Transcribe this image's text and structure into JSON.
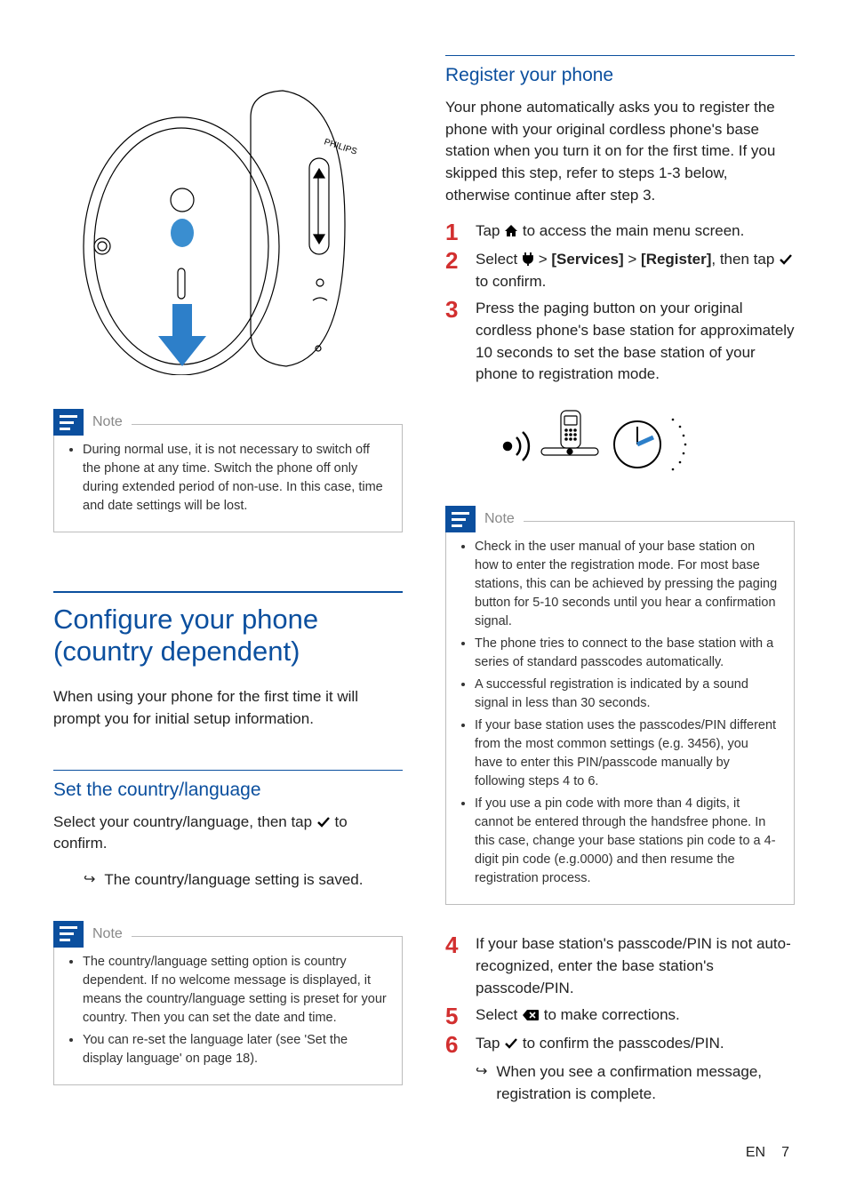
{
  "left": {
    "note1": {
      "title": "Note",
      "items": [
        "During normal use, it is not necessary to switch off the phone at any time. Switch the phone off only during extended period of non-use. In this case, time and date settings will be lost."
      ]
    },
    "section_title": "Configure your phone (country dependent)",
    "section_intro": "When using your phone for the first time it will prompt you for initial setup information.",
    "sub1_title": "Set the country/language",
    "sub1_body_a": "Select your country/language, then tap ",
    "sub1_body_b": " to confirm.",
    "sub1_result": "The country/language setting is saved.",
    "note2": {
      "title": "Note",
      "items": [
        "The country/language setting option is country dependent. If no welcome message is displayed, it means the country/language setting is preset for your country. Then you can set the date and time.",
        "You can re-set the language later (see 'Set the display language' on page 18)."
      ]
    }
  },
  "right": {
    "sub_title": "Register your phone",
    "intro": "Your phone automatically asks you to register the phone with your original cordless phone's base station when you turn it on for the first time. If you skipped this step, refer to steps 1-3 below, otherwise continue after step 3.",
    "step1_a": "Tap ",
    "step1_b": " to access the main menu screen.",
    "step2_a": "Select ",
    "step2_b": " > ",
    "step2_services": "[Services]",
    "step2_c": " > ",
    "step2_register": "[Register]",
    "step2_d": ", then tap ",
    "step2_e": " to confirm.",
    "step3": "Press the paging button on your original cordless phone's base station for approximately 10 seconds to set the base station of your phone to registration mode.",
    "note": {
      "title": "Note",
      "items": [
        "Check in the user manual of your base station on how to enter the registration mode. For most base stations, this can be achieved by pressing the paging button for 5-10 seconds until you hear a confirmation signal.",
        "The phone tries to connect to the base station with a series of standard passcodes automatically.",
        "A successful registration is indicated by a sound signal in less than 30 seconds.",
        "If your base station uses the passcodes/PIN different from the most common settings (e.g. 3456), you have to enter this PIN/passcode manually by following steps 4 to 6.",
        "If you use a pin code with more than 4 digits, it cannot be entered through the handsfree phone. In this case, change your base stations pin code to a 4-digit pin code (e.g.0000) and then resume the registration process."
      ]
    },
    "step4": "If your base station's passcode/PIN is not auto-recognized, enter the base station's passcode/PIN.",
    "step5_a": "Select ",
    "step5_b": " to make corrections.",
    "step6_a": "Tap ",
    "step6_b": " to confirm the passcodes/PIN.",
    "step6_result": "When you see a confirmation message, registration is complete."
  },
  "footer": {
    "lang": "EN",
    "page": "7"
  },
  "nums": {
    "n1": "1",
    "n2": "2",
    "n3": "3",
    "n4": "4",
    "n5": "5",
    "n6": "6"
  }
}
